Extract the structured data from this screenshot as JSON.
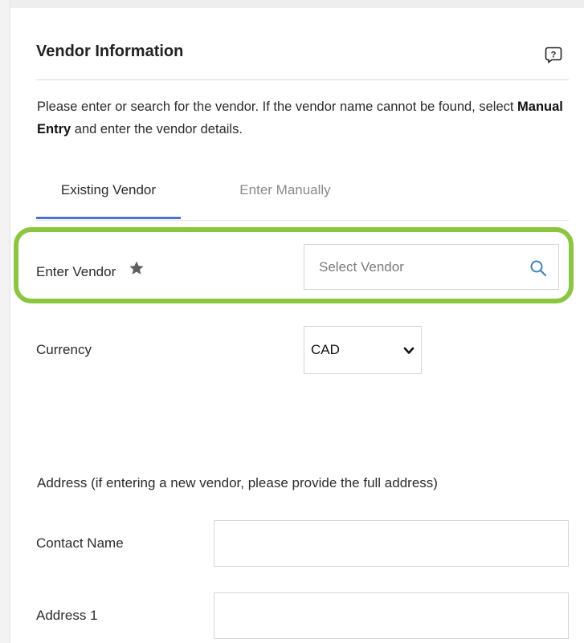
{
  "section": {
    "title": "Vendor Information",
    "intro_part1": "Please enter or search for the vendor. If the vendor name cannot be found, select ",
    "intro_bold": "Manual Entry",
    "intro_part2": " and enter the vendor details."
  },
  "tabs": [
    {
      "label": "Existing Vendor",
      "active": true
    },
    {
      "label": "Enter Manually",
      "active": false
    }
  ],
  "vendor_field": {
    "label": "Enter Vendor",
    "placeholder": "Select Vendor",
    "value": ""
  },
  "currency_field": {
    "label": "Currency",
    "selected": "CAD"
  },
  "address": {
    "note": "Address (if entering a new vendor, please provide the full address)",
    "contact_name_label": "Contact Name",
    "contact_name_value": "",
    "address1_label": "Address 1",
    "address1_value": ""
  },
  "icons": {
    "help": "help-icon",
    "required": "star-icon",
    "search": "search-icon",
    "dropdown": "chevron-down-icon"
  },
  "colors": {
    "highlight": "#8cc63f",
    "active_tab": "#4a72d3",
    "search_icon": "#3b82c4"
  }
}
